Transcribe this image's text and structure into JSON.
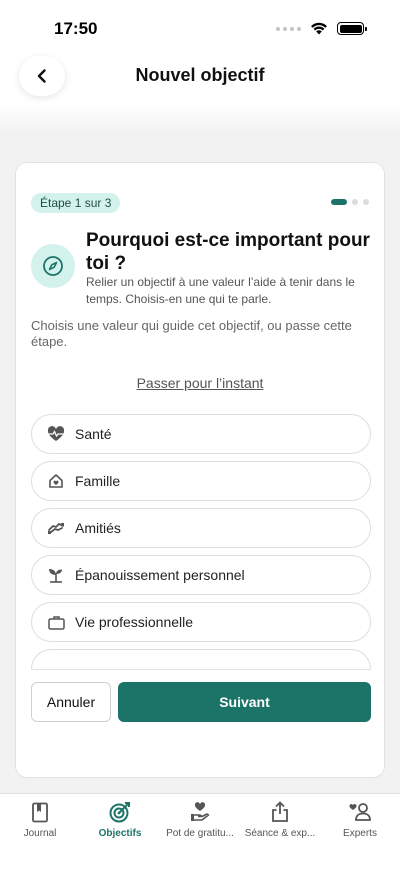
{
  "status_bar": {
    "time": "17:50"
  },
  "header": {
    "title": "Nouvel objectif"
  },
  "card": {
    "step_label": "Étape 1 sur 3",
    "question_title": "Pourquoi est-ce important pour toi ?",
    "question_subtitle": "Relier un objectif à une valeur l’aide à tenir dans le temps. Choisis-en une qui te parle.",
    "intro": "Choisis une valeur qui guide cet objectif, ou passe cette étape.",
    "skip_label": "Passer pour l’instant",
    "values": [
      {
        "label": "Santé",
        "icon": "heart-pulse-icon"
      },
      {
        "label": "Famille",
        "icon": "home-heart-icon"
      },
      {
        "label": "Amitiés",
        "icon": "handshake-icon"
      },
      {
        "label": "Épanouissement personnel",
        "icon": "sprout-icon"
      },
      {
        "label": "Vie professionnelle",
        "icon": "briefcase-icon"
      }
    ],
    "cancel_label": "Annuler",
    "next_label": "Suivant"
  },
  "tabs": [
    {
      "label": "Journal",
      "icon": "journal-icon",
      "active": false
    },
    {
      "label": "Objectifs",
      "icon": "target-icon",
      "active": true
    },
    {
      "label": "Pot de gratitu...",
      "icon": "gratitude-hand-icon",
      "active": false
    },
    {
      "label": "Séance & exp...",
      "icon": "share-icon",
      "active": false
    },
    {
      "label": "Experts",
      "icon": "experts-icon",
      "active": false
    }
  ],
  "colors": {
    "accent": "#1c7469",
    "accent_light": "#d3f2ec"
  }
}
